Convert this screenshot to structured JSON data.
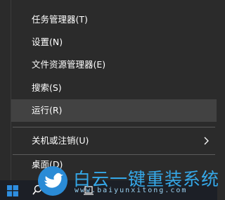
{
  "menu": {
    "items": [
      {
        "label": "任务管理器(T)"
      },
      {
        "label": "设置(N)"
      },
      {
        "label": "文件资源管理器(E)"
      },
      {
        "label": "搜索(S)"
      },
      {
        "label": "运行(R)"
      },
      {
        "label": "关机或注销(U)"
      },
      {
        "label": "桌面(D)"
      }
    ]
  },
  "watermark": {
    "title": "白云一键重装系统",
    "url": "www.baiyunxitong.com"
  },
  "colors": {
    "menu_bg": "#2b2b2b",
    "hover_bg": "#424242",
    "accent": "#35a8e8"
  }
}
